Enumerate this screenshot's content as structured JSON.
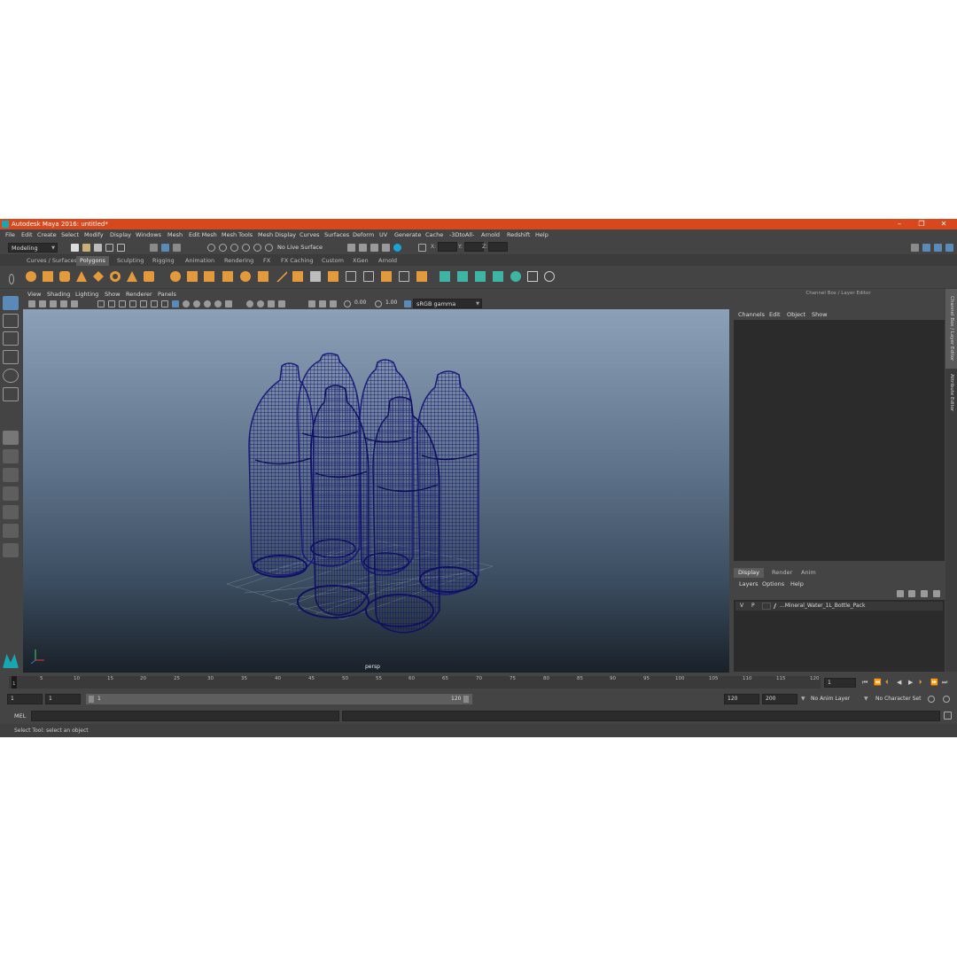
{
  "window": {
    "title": "Autodesk Maya 2016: untitled*",
    "controls": [
      "–",
      "❐",
      "✕"
    ]
  },
  "menubar": [
    "File",
    "Edit",
    "Create",
    "Select",
    "Modify",
    "Display",
    "Windows",
    "Mesh",
    "Edit Mesh",
    "Mesh Tools",
    "Mesh Display",
    "Curves",
    "Surfaces",
    "Deform",
    "UV",
    "Generate",
    "Cache",
    "-3DtoAll-",
    "Arnold",
    "Redshift",
    "Help"
  ],
  "statusline": {
    "mode": "Modeling",
    "live_surface": "No Live Surface",
    "x_label": "X:",
    "y_label": "Y:",
    "z_label": "Z:"
  },
  "shelf_tabs": [
    "Curves / Surfaces",
    "Polygons",
    "Sculpting",
    "Rigging",
    "Animation",
    "Rendering",
    "FX",
    "FX Caching",
    "Custom",
    "XGen",
    "Arnold"
  ],
  "shelf_active": "Polygons",
  "panel_menu": [
    "View",
    "Shading",
    "Lighting",
    "Show",
    "Renderer",
    "Panels"
  ],
  "panel_toolbar": {
    "exposure": "0.00",
    "gamma": "1.00",
    "color_space": "sRGB gamma"
  },
  "viewport": {
    "camera": "persp",
    "wire_color": "#1a1a7a"
  },
  "channel_box": {
    "header": "Channel Box / Layer Editor",
    "menu": [
      "Channels",
      "Edit",
      "Object",
      "Show"
    ]
  },
  "side_tabs": [
    "Channel Box / Layer Editor",
    "Attribute Editor"
  ],
  "layer_editor": {
    "tabs": [
      "Display",
      "Render",
      "Anim"
    ],
    "menu": [
      "Layers",
      "Options",
      "Help"
    ],
    "layers": [
      {
        "v": "V",
        "p": "P",
        "name": "...Mineral_Water_1L_Bottle_Pack"
      }
    ]
  },
  "timeline": {
    "ticks": [
      "1",
      "5",
      "10",
      "15",
      "20",
      "25",
      "30",
      "35",
      "40",
      "45",
      "50",
      "55",
      "60",
      "65",
      "70",
      "75",
      "80",
      "85",
      "90",
      "95",
      "100",
      "105",
      "110",
      "115",
      "120"
    ],
    "current_frame": "1"
  },
  "range": {
    "start": "1",
    "anim_start": "1",
    "slider_start": "1",
    "slider_end": "120",
    "end": "120",
    "anim_end": "200",
    "anim_layer": "No Anim Layer",
    "character_set": "No Character Set"
  },
  "command_line": {
    "lang": "MEL"
  },
  "help_line": "Select Tool: select an object",
  "colors": {
    "titlebar": "#d9481c",
    "accent": "#18a6b0",
    "shelf_orange": "#e29a3c",
    "shelf_teal": "#3fb3a4"
  }
}
